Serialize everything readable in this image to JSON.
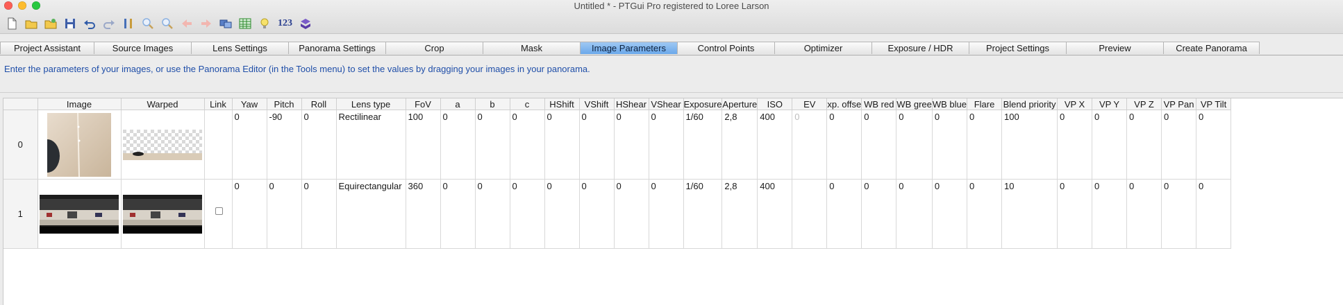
{
  "window": {
    "title": "Untitled * - PTGui Pro registered to Loree Larson"
  },
  "toolbar": {
    "icons": [
      "new-document-icon",
      "open-folder-icon",
      "open-recent-icon",
      "save-icon",
      "undo-icon",
      "redo-icon",
      "tools-icon",
      "zoom-in-icon",
      "zoom-out-icon",
      "back-arrow-icon",
      "forward-arrow-icon",
      "panorama-editor-icon",
      "table-icon",
      "lightbulb-icon",
      "numeric-icon",
      "batch-icon"
    ],
    "numeric_label": "123"
  },
  "tabs": [
    {
      "label": "Project Assistant",
      "active": false
    },
    {
      "label": "Source Images",
      "active": false
    },
    {
      "label": "Lens Settings",
      "active": false
    },
    {
      "label": "Panorama Settings",
      "active": false
    },
    {
      "label": "Crop",
      "active": false
    },
    {
      "label": "Mask",
      "active": false
    },
    {
      "label": "Image Parameters",
      "active": true
    },
    {
      "label": "Control Points",
      "active": false
    },
    {
      "label": "Optimizer",
      "active": false
    },
    {
      "label": "Exposure / HDR",
      "active": false
    },
    {
      "label": "Project Settings",
      "active": false
    },
    {
      "label": "Preview",
      "active": false
    },
    {
      "label": "Create Panorama",
      "active": false
    }
  ],
  "instruction": "Enter the parameters of your images, or use the Panorama Editor (in the Tools menu) to set the values by dragging your images in your panorama.",
  "table": {
    "headers": [
      "",
      "Image",
      "Warped",
      "Link",
      "Yaw",
      "Pitch",
      "Roll",
      "Lens type",
      "FoV",
      "a",
      "b",
      "c",
      "HShift",
      "VShift",
      "HShear",
      "VShear",
      "Exposure",
      "Aperture",
      "ISO",
      "EV",
      "xp. offse",
      "WB red",
      "WB gree",
      "WB blue",
      "Flare",
      "Blend priority",
      "VP X",
      "VP Y",
      "VP Z",
      "VP Pan",
      "VP Tilt"
    ],
    "rows": [
      {
        "index": "0",
        "link": "",
        "yaw": "0",
        "pitch": "-90",
        "roll": "0",
        "lens_type": "Rectilinear",
        "fov": "100",
        "a": "0",
        "b": "0",
        "c": "0",
        "hshift": "0",
        "vshift": "0",
        "hshear": "0",
        "vshear": "0",
        "exposure": "1/60",
        "aperture": "2,8",
        "iso": "400",
        "ev": "0",
        "exp_offset": "0",
        "wb_red": "0",
        "wb_green": "0",
        "wb_blue": "0",
        "flare": "0",
        "blend_priority": "100",
        "vp_x": "0",
        "vp_y": "0",
        "vp_z": "0",
        "vp_pan": "0",
        "vp_tilt": "0"
      },
      {
        "index": "1",
        "link": "checkbox",
        "yaw": "0",
        "pitch": "0",
        "roll": "0",
        "lens_type": "Equirectangular",
        "fov": "360",
        "a": "0",
        "b": "0",
        "c": "0",
        "hshift": "0",
        "vshift": "0",
        "hshear": "0",
        "vshear": "0",
        "exposure": "1/60",
        "aperture": "2,8",
        "iso": "400",
        "ev": "",
        "exp_offset": "0",
        "wb_red": "0",
        "wb_green": "0",
        "wb_blue": "0",
        "flare": "0",
        "blend_priority": "10",
        "vp_x": "0",
        "vp_y": "0",
        "vp_z": "0",
        "vp_pan": "0",
        "vp_tilt": "0"
      }
    ]
  },
  "colors": {
    "active_tab": "#6aa8ea",
    "instruction_text": "#1f4ea8"
  }
}
